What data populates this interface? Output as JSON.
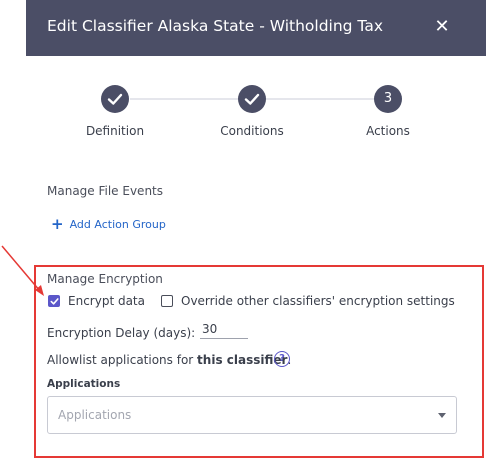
{
  "modal": {
    "title": "Edit Classifier Alaska State - Witholding Tax",
    "close_symbol": "✕"
  },
  "stepper": {
    "steps": [
      {
        "label": "Definition",
        "state": "complete"
      },
      {
        "label": "Conditions",
        "state": "complete"
      },
      {
        "label": "Actions",
        "number": "3",
        "state": "current"
      }
    ]
  },
  "file_events": {
    "section_label": "Manage File Events",
    "add_action_group_label": "Add Action Group"
  },
  "encryption": {
    "section_label": "Manage Encryption",
    "encrypt_data_label": "Encrypt data",
    "encrypt_data_checked": true,
    "override_label": "Override other classifiers' encryption settings",
    "override_checked": false,
    "delay_label": "Encryption Delay (days):",
    "delay_value": "30",
    "allowlist_prefix": "Allowlist applications for ",
    "allowlist_bold": "this classifier",
    "allowlist_suffix": ".",
    "help_symbol": "?",
    "applications_heading": "Applications",
    "applications_placeholder": "Applications"
  },
  "colors": {
    "header_bg": "#4b4e66",
    "accent": "#5b57c9",
    "link": "#2465c8",
    "highlight_box": "#e53935"
  }
}
